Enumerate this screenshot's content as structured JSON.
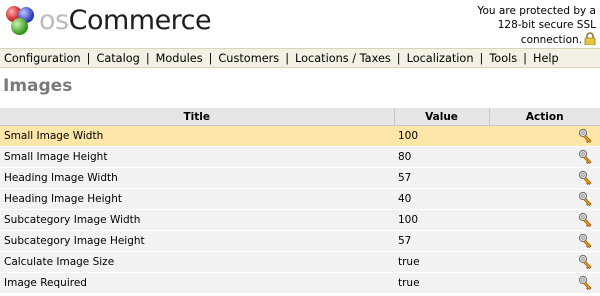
{
  "header": {
    "brand_os": "os",
    "brand_name": "Commerce",
    "ssl_line1": "You are protected by a",
    "ssl_line2": "128-bit secure SSL",
    "ssl_line3": "connection."
  },
  "menu": {
    "items": [
      {
        "label": "Configuration"
      },
      {
        "label": "Catalog"
      },
      {
        "label": "Modules"
      },
      {
        "label": "Customers"
      },
      {
        "label": "Locations / Taxes"
      },
      {
        "label": "Localization"
      },
      {
        "label": "Tools"
      },
      {
        "label": "Help"
      }
    ],
    "separator": "|"
  },
  "page": {
    "title": "Images"
  },
  "table": {
    "columns": {
      "title": "Title",
      "value": "Value",
      "action": "Action"
    },
    "rows": [
      {
        "title": "Small Image Width",
        "value": "100",
        "action_icon": "edit-key-icon"
      },
      {
        "title": "Small Image Height",
        "value": "80",
        "action_icon": "edit-key-icon"
      },
      {
        "title": "Heading Image Width",
        "value": "57",
        "action_icon": "edit-key-icon"
      },
      {
        "title": "Heading Image Height",
        "value": "40",
        "action_icon": "edit-key-icon"
      },
      {
        "title": "Subcategory Image Width",
        "value": "100",
        "action_icon": "edit-key-icon"
      },
      {
        "title": "Subcategory Image Height",
        "value": "57",
        "action_icon": "edit-key-icon"
      },
      {
        "title": "Calculate Image Size",
        "value": "true",
        "action_icon": "edit-key-icon"
      },
      {
        "title": "Image Required",
        "value": "true",
        "action_icon": "edit-key-icon"
      }
    ],
    "selected_row": "Small Image Width"
  },
  "colors": {
    "menu_bg": "#f2f1e3",
    "header_row_bg": "#e5e5e5",
    "row_bg": "#f2f2f2",
    "selected_row_bg": "#fde6a8",
    "title_gray": "#7a7a7a"
  }
}
